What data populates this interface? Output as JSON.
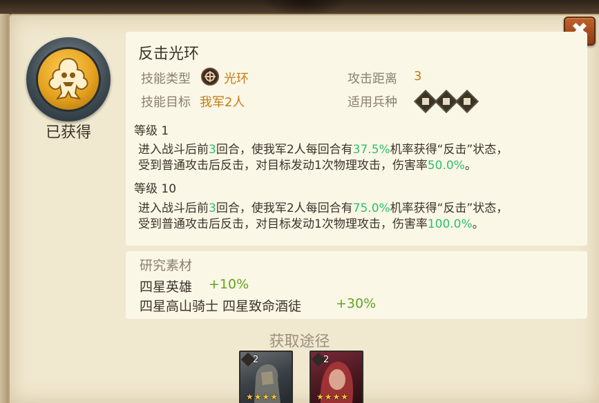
{
  "close_button": {
    "label": "✖",
    "icon": "close-icon"
  },
  "emblem": {
    "icon": "counterattack-skill-icon",
    "status": "已获得"
  },
  "skill": {
    "name": "反击光环",
    "type_label": "技能类型",
    "type_icon": "aura-type-icon",
    "type_value": "光环",
    "range_label": "攻击距离",
    "range_value": "3",
    "target_label": "技能目标",
    "target_value": "我军2人",
    "troop_label": "适用兵种",
    "troop_icons": [
      "sword-troop-icon",
      "horse-troop-icon",
      "bow-troop-icon"
    ]
  },
  "levels": [
    {
      "label": "等级 1",
      "parts": [
        "进入战斗后前",
        "3",
        "回合，使我军2人每回合有",
        "37.5%",
        "机率获得“反击”状态，",
        "受到普通攻击后反击，对目标发动1次物理攻击，伤害率",
        "50.0%",
        "。"
      ]
    },
    {
      "label": "等级 10",
      "parts": [
        "进入战斗后前",
        "3",
        "回合，使我军2人每回合有",
        "75.0%",
        "机率获得“反击”状态，",
        "受到普通攻击后反击，对目标发动1次物理攻击，伤害率",
        "100.0%",
        "。"
      ]
    }
  ],
  "research": {
    "title": "研究素材",
    "items": [
      {
        "name": "四星英雄",
        "bonus": "+10%"
      },
      {
        "name": "四星高山骑士 四星致命酒徒",
        "bonus": "+30%"
      }
    ]
  },
  "sources": {
    "title": "获取途径",
    "cards": [
      {
        "count": "2",
        "stars": "★★★★",
        "icon": "armored-knight-portrait"
      },
      {
        "count": "2",
        "stars": "★★★★",
        "icon": "red-hair-hero-portrait"
      }
    ]
  },
  "colors": {
    "panel": "#f0e8cf",
    "box": "#fbf7e7",
    "accent_orange": "#c47a12",
    "highlight_green": "#2cbf6a",
    "bonus_green": "#5fa51e",
    "close_button": "#b0552a"
  }
}
